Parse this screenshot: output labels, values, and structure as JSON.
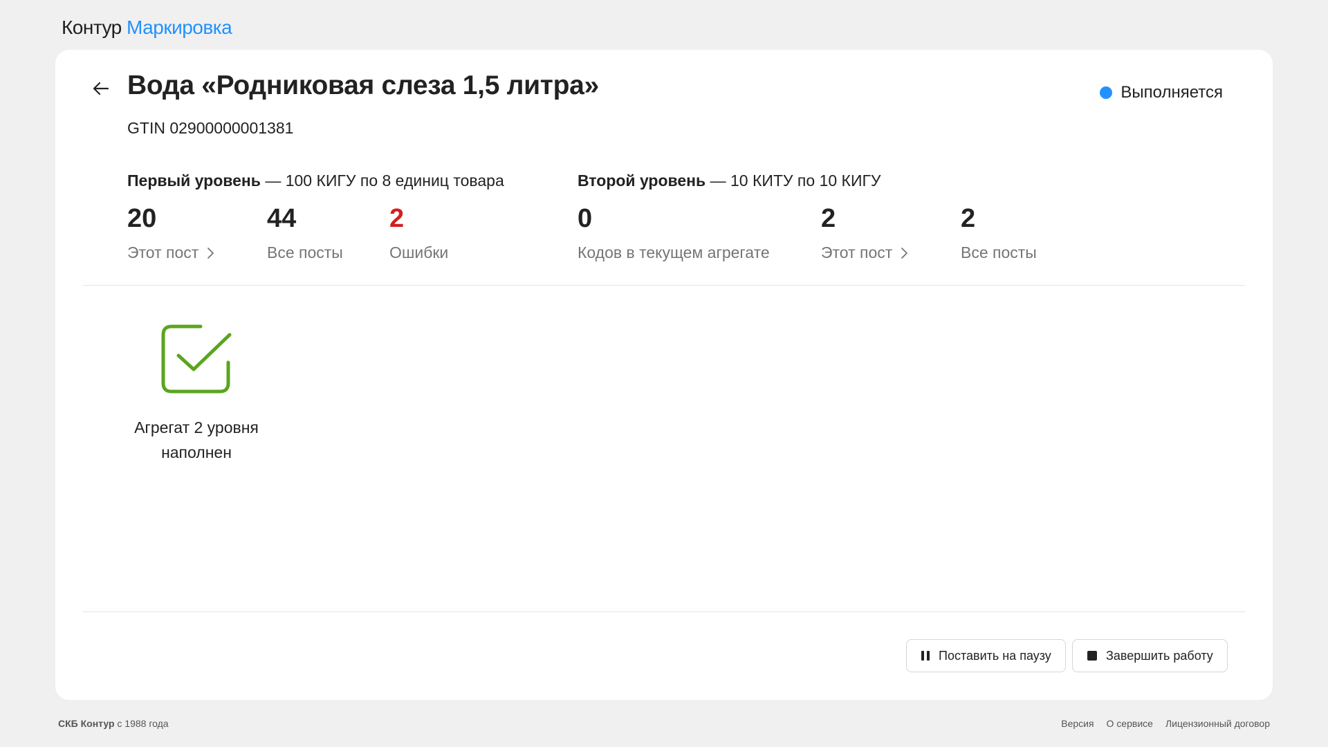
{
  "header": {
    "brand": "Контур",
    "product": "Маркировка"
  },
  "task": {
    "title": "Вода «Родниковая слеза 1,5 литра»",
    "gtin": "GTIN 02900000001381",
    "status_label": "Выполняется",
    "status_color": "#2291ff"
  },
  "level1": {
    "name": "Первый уровень",
    "desc": " — 100 КИГУ по 8 единиц товара",
    "stats": [
      {
        "value": "20",
        "label": "Этот пост"
      },
      {
        "value": "44",
        "label": "Все посты"
      },
      {
        "value": "2",
        "label": "Ошибки",
        "color": "#d32020"
      }
    ]
  },
  "level2": {
    "name": "Второй уровень",
    "desc": " — 10 КИТУ по 10 КИГУ",
    "stats": [
      {
        "value": "0",
        "label": "Кодов в текущем агрегате"
      },
      {
        "value": "2",
        "label": "Этот пост"
      },
      {
        "value": "2",
        "label": "Все посты"
      }
    ]
  },
  "aggregate": {
    "line1": "Агрегат 2 уровня",
    "line2": "наполнен",
    "icon": "check-square-icon",
    "icon_color": "#5aa51e"
  },
  "actions": {
    "pause_label": "Поставить на паузу",
    "finish_label": "Завершить работу"
  },
  "footer": {
    "company": "СКБ Контур",
    "since": " с 1988 года",
    "links": [
      "Версия",
      "О сервисе",
      "Лицензионный договор"
    ]
  }
}
